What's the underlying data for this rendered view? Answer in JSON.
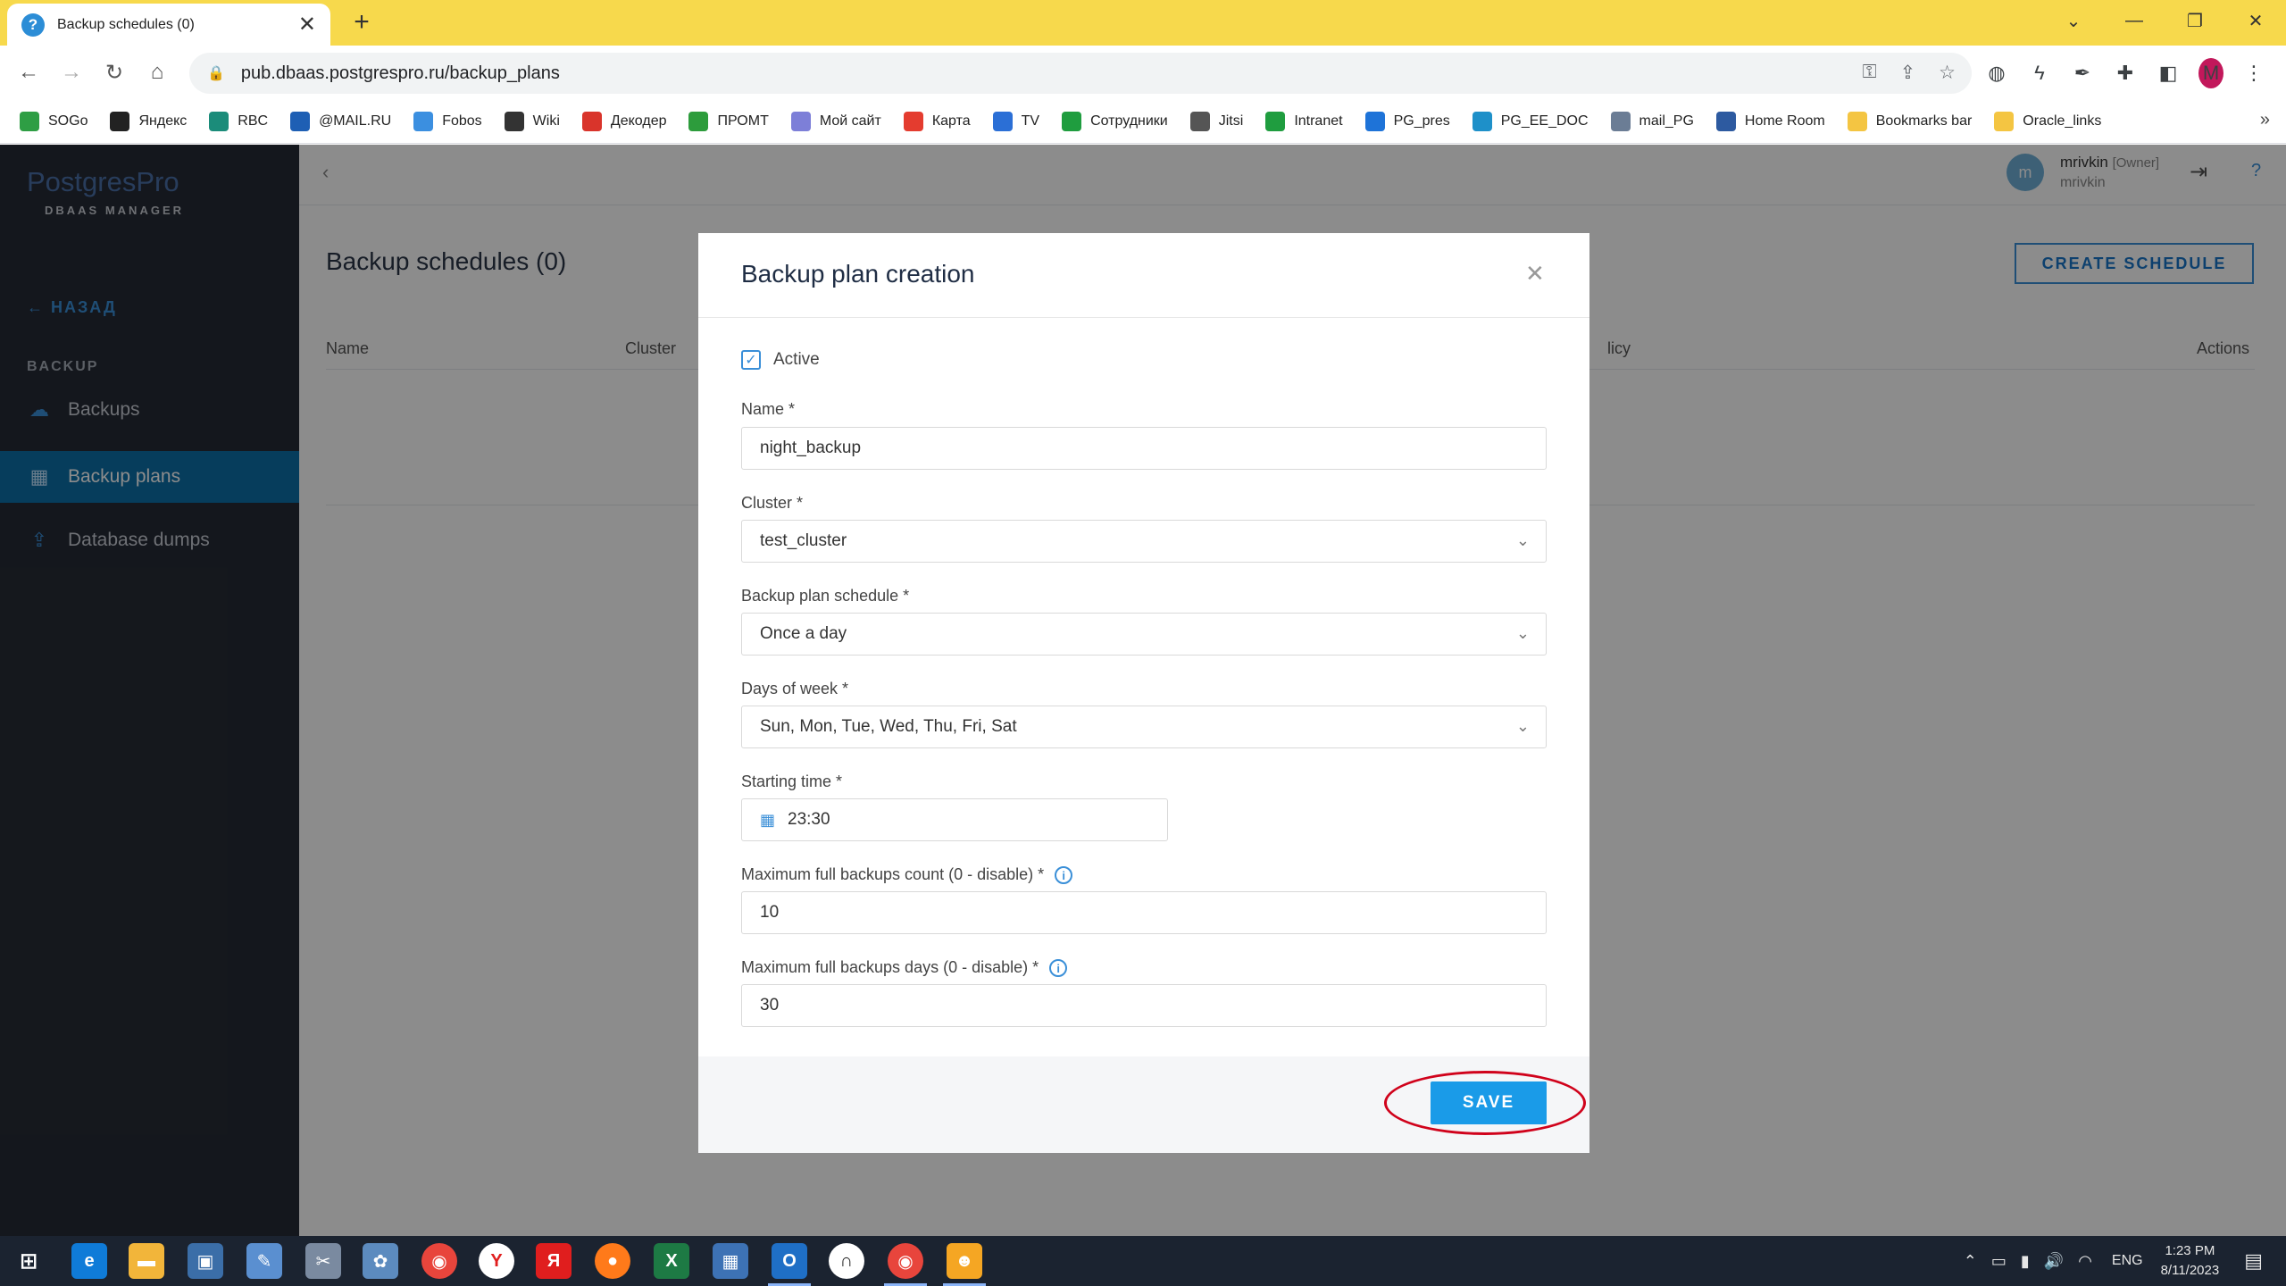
{
  "browser": {
    "tab_title": "Backup schedules (0)",
    "tab_close": "✕",
    "new_tab": "+",
    "url": "pub.dbaas.postgrespro.ru/backup_plans",
    "profile_initial": "M",
    "bookmarks": [
      {
        "label": "SOGo",
        "color": "#2e9e44"
      },
      {
        "label": "Яндекс",
        "color": "#222222"
      },
      {
        "label": "RBC",
        "color": "#1b8c7a"
      },
      {
        "label": "@MAIL.RU",
        "color": "#1e5fb4"
      },
      {
        "label": "Fobos",
        "color": "#3b8fe0"
      },
      {
        "label": "Wiki",
        "color": "#333333"
      },
      {
        "label": "Декодер",
        "color": "#d9342b"
      },
      {
        "label": "ПРОМТ",
        "color": "#2d9c3c"
      },
      {
        "label": "Мой сайт",
        "color": "#7d7fd8"
      },
      {
        "label": "Карта",
        "color": "#e43c2f"
      },
      {
        "label": "TV",
        "color": "#2b6fd6"
      },
      {
        "label": "Сотрудники",
        "color": "#1f9d3f"
      },
      {
        "label": "Jitsi",
        "color": "#555555"
      },
      {
        "label": "Intranet",
        "color": "#1f9d3f"
      },
      {
        "label": "PG_pres",
        "color": "#1e73d8"
      },
      {
        "label": "PG_EE_DOC",
        "color": "#1e90c9"
      },
      {
        "label": "mail_PG",
        "color": "#6b7d95"
      },
      {
        "label": "Home Room",
        "color": "#2d5aa0"
      },
      {
        "label": "Bookmarks bar",
        "color": "#f4c542"
      },
      {
        "label": "Oracle_links",
        "color": "#f4c542"
      }
    ]
  },
  "sidebar": {
    "logo": "PostgresPro",
    "logo_sub": "DBAAS MANAGER",
    "back": "← НАЗАД",
    "section": "BACKUP",
    "items": [
      {
        "label": "Backups",
        "icon": "cloud-upload-icon"
      },
      {
        "label": "Backup plans",
        "icon": "calendar-icon"
      },
      {
        "label": "Database dumps",
        "icon": "dump-icon"
      }
    ]
  },
  "topbar": {
    "avatar": "m",
    "user": "mrivkin",
    "role": "[Owner]",
    "login": "mrivkin"
  },
  "page": {
    "title": "Backup schedules (0)",
    "create_button": "CREATE SCHEDULE",
    "columns": {
      "name": "Name",
      "cluster": "Cluster",
      "policy": "licy",
      "actions": "Actions"
    }
  },
  "modal": {
    "title": "Backup plan creation",
    "active_label": "Active",
    "active_checked": true,
    "name_label": "Name *",
    "name_value": "night_backup",
    "cluster_label": "Cluster *",
    "cluster_value": "test_cluster",
    "schedule_label": "Backup plan schedule *",
    "schedule_value": "Once a day",
    "days_label": "Days of week *",
    "days_value": "Sun, Mon, Tue, Wed, Thu, Fri, Sat",
    "time_label": "Starting time *",
    "time_value": "23:30",
    "max_count_label": "Maximum full backups count (0 - disable) *",
    "max_count_value": "10",
    "max_days_label": "Maximum full backups days (0 - disable) *",
    "max_days_value": "30",
    "save": "SAVE"
  },
  "taskbar": {
    "lang": "ENG",
    "time": "1:23 PM",
    "date": "8/11/2023"
  }
}
